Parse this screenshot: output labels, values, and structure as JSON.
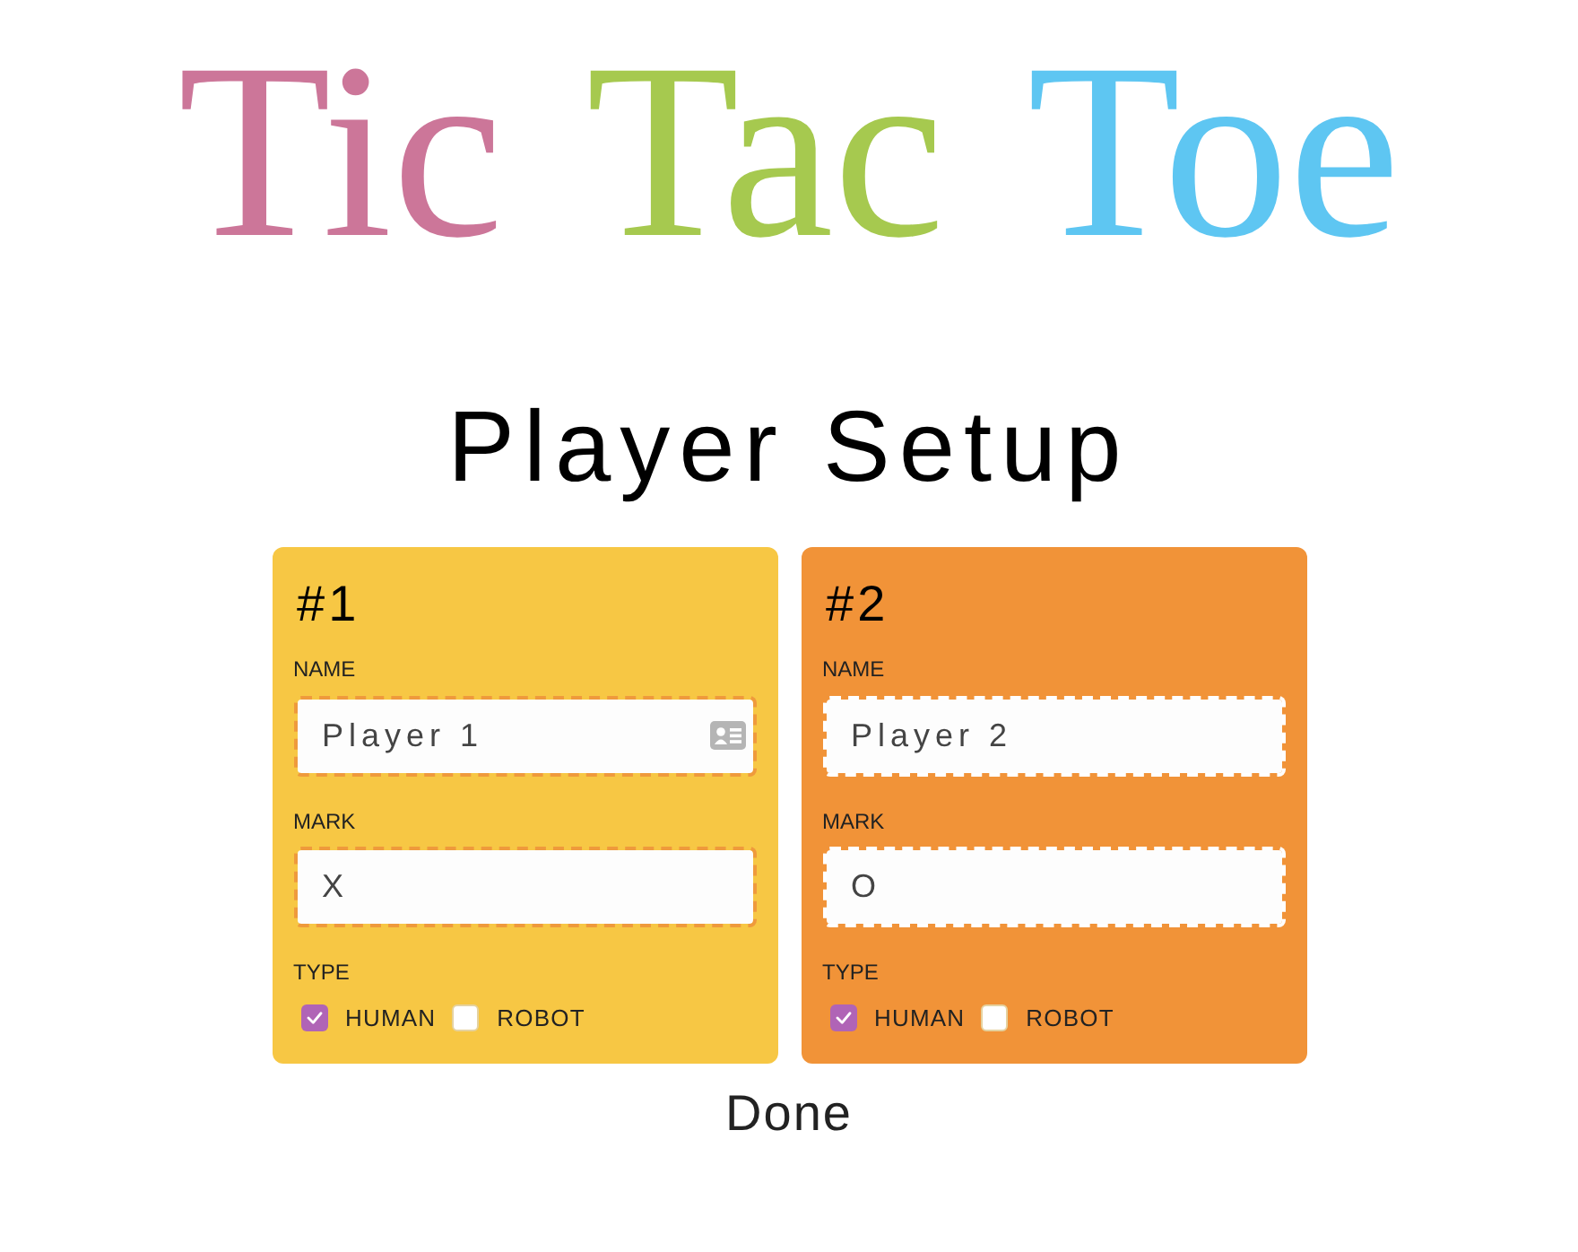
{
  "title": [
    {
      "text": "Tic",
      "color": "#cc7699"
    },
    {
      "text": "Tac",
      "color": "#a6c94f"
    },
    {
      "text": "Toe",
      "color": "#5ec6f2"
    }
  ],
  "heading": "Player Setup",
  "players": [
    {
      "number": "#1",
      "color": "#f7c744",
      "name_label": "NAME",
      "name_value": "Player 1",
      "autofill_icon": true,
      "mark_label": "MARK",
      "mark_value": "X",
      "type_label": "TYPE",
      "type_options": [
        {
          "label": "HUMAN",
          "checked": true
        },
        {
          "label": "ROBOT",
          "checked": false
        }
      ]
    },
    {
      "number": "#2",
      "color": "#f19338",
      "name_label": "NAME",
      "name_value": "Player 2",
      "autofill_icon": false,
      "mark_label": "MARK",
      "mark_value": "O",
      "type_label": "TYPE",
      "type_options": [
        {
          "label": "HUMAN",
          "checked": true
        },
        {
          "label": "ROBOT",
          "checked": false
        }
      ]
    }
  ],
  "done_button": "Done"
}
